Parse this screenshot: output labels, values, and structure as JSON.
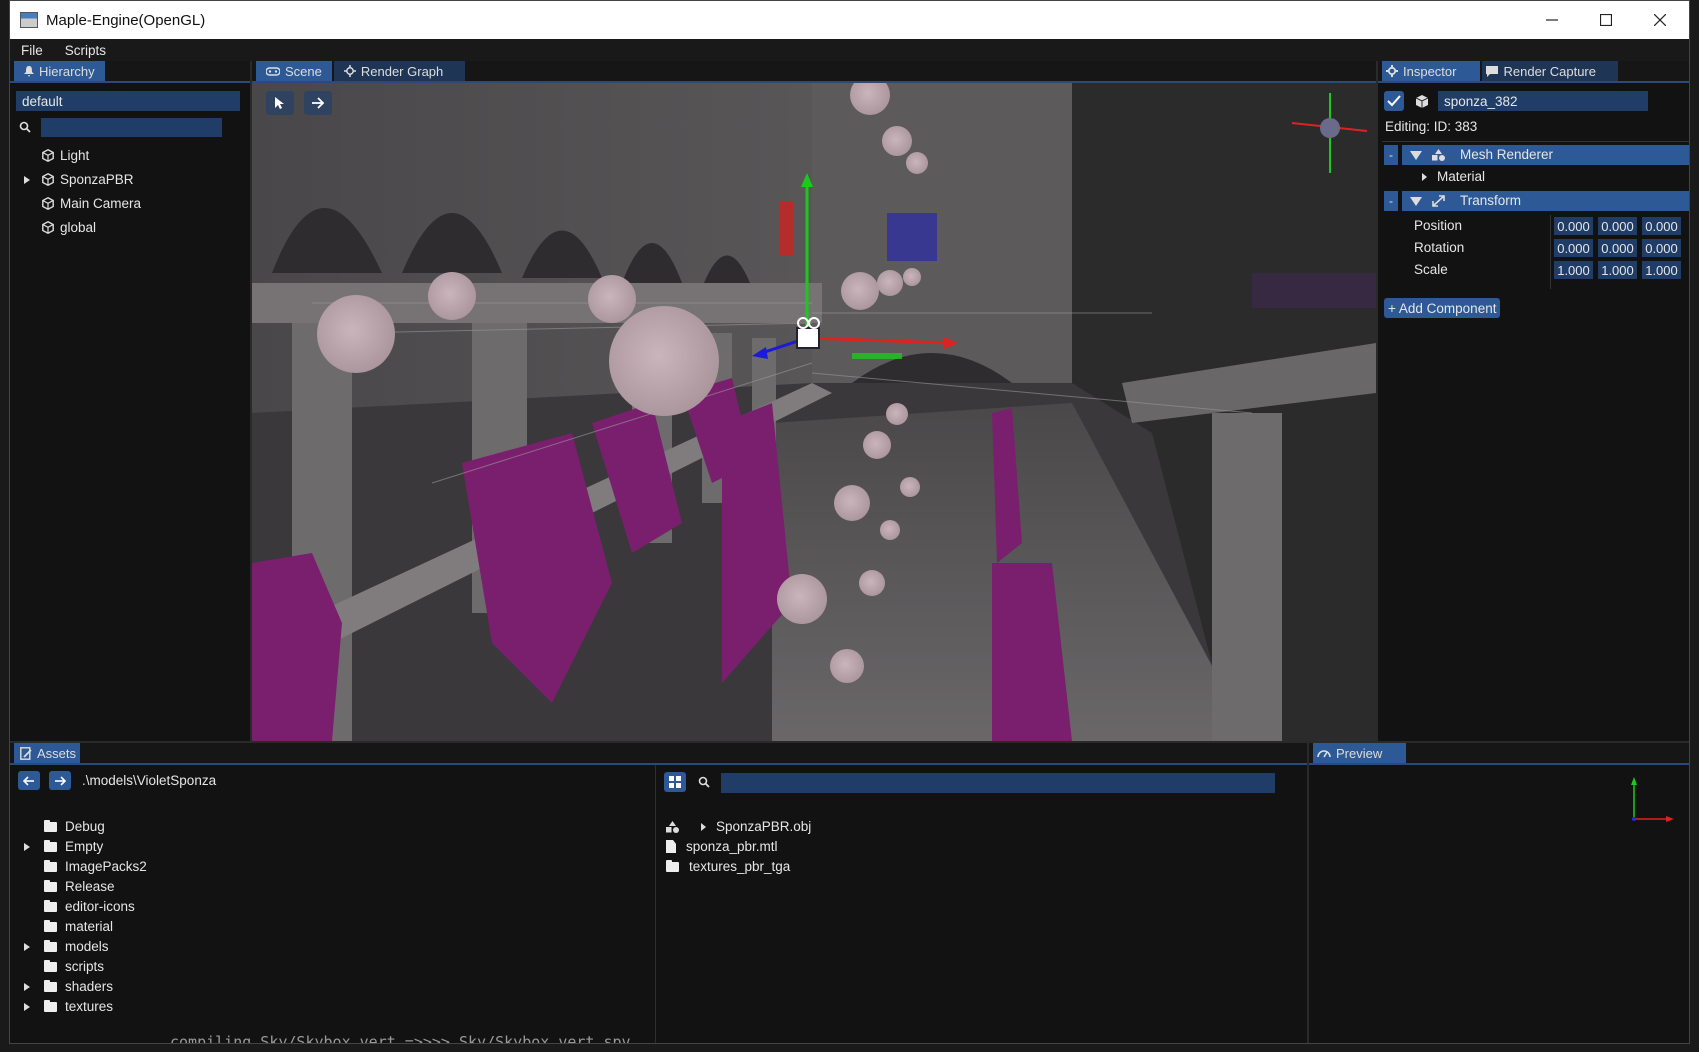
{
  "window": {
    "title": "Maple-Engine(OpenGL)"
  },
  "menu": {
    "file": "File",
    "scripts": "Scripts"
  },
  "hierarchy": {
    "tab": "Hierarchy",
    "scene_name": "default",
    "search_placeholder": "",
    "items": [
      {
        "label": "Light",
        "expandable": false
      },
      {
        "label": "SponzaPBR",
        "expandable": true
      },
      {
        "label": "Main Camera",
        "expandable": false
      },
      {
        "label": "global",
        "expandable": false
      }
    ]
  },
  "viewport": {
    "tabs": [
      {
        "label": "Scene"
      },
      {
        "label": "Render Graph"
      }
    ]
  },
  "inspector": {
    "tabs": [
      {
        "label": "Inspector"
      },
      {
        "label": "Render Capture"
      }
    ],
    "entity_name": "sponza_382",
    "editing": "Editing:  ID: 383",
    "components": {
      "mesh_renderer": {
        "label": "Mesh Renderer",
        "remove": "-",
        "material": "Material"
      },
      "transform": {
        "label": "Transform",
        "remove": "-",
        "rows": [
          {
            "label": "Position",
            "values": [
              "0.000",
              "0.000",
              "0.000"
            ]
          },
          {
            "label": "Rotation",
            "values": [
              "0.000",
              "0.000",
              "0.000"
            ]
          },
          {
            "label": "Scale",
            "values": [
              "1.000",
              "1.000",
              "1.000"
            ]
          }
        ]
      }
    },
    "add_component": "+ Add Component"
  },
  "assets": {
    "tab": "Assets",
    "path": ".\\models\\VioletSponza",
    "search_placeholder": "",
    "folders": [
      {
        "label": "Debug",
        "expandable": false
      },
      {
        "label": "Empty",
        "expandable": true
      },
      {
        "label": "ImagePacks2",
        "expandable": false
      },
      {
        "label": "Release",
        "expandable": false
      },
      {
        "label": "editor-icons",
        "expandable": false
      },
      {
        "label": "material",
        "expandable": false
      },
      {
        "label": "models",
        "expandable": true
      },
      {
        "label": "scripts",
        "expandable": false
      },
      {
        "label": "shaders",
        "expandable": true
      },
      {
        "label": "textures",
        "expandable": true
      }
    ],
    "files": [
      {
        "label": "SponzaPBR.obj",
        "kind": "mesh"
      },
      {
        "label": "sponza_pbr.mtl",
        "kind": "file"
      },
      {
        "label": "textures_pbr_tga",
        "kind": "folder"
      }
    ]
  },
  "preview": {
    "tab": "Preview"
  },
  "console_text": "compiling Sky/Skybox.vert =>>>> Sky/Skybox.vert.spv",
  "colors": {
    "accent": "#2d5a96",
    "field": "#1f3d66",
    "curtain": "#7a1f6e"
  }
}
